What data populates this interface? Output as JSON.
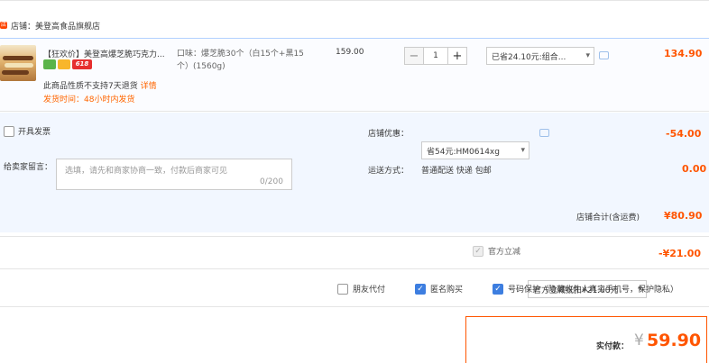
{
  "shop": {
    "name": "店铺：美登高食品旗舰店"
  },
  "item": {
    "title": "【狂欢价】美登高爆芝脆巧克力...",
    "badge_618": "618",
    "no_return": "此商品性质不支持7天退货",
    "detail_link": "详情",
    "ship_time": "发货时间：48小时内发货",
    "attr": "口味：爆芝脆30个（白15个+黑15个）(1560g)",
    "price": "159.00",
    "qty": "1",
    "qty_minus": "−",
    "qty_plus": "+",
    "promo": "已省24.10元:组合...",
    "total": "134.90"
  },
  "extras": {
    "invoice_label": "开具发票",
    "message_label": "给卖家留言：",
    "message_placeholder": "选填，请先和商家协商一致，付款后商家可见",
    "message_count": "0/200",
    "coupon_label": "店铺优惠：",
    "coupon_value": "省54元:HM0614xg",
    "coupon_amount": "-54.00",
    "shipping_label": "运送方式：",
    "shipping_value": "普通配送 快递 包邮",
    "shipping_amount": "0.00",
    "subtotal_label": "店铺合计(含运费)",
    "subtotal_amount": "¥80.90"
  },
  "direct": {
    "label": "官方立减",
    "value": "官方立减抵扣¥21.00元",
    "amount": "-¥21.00"
  },
  "options": {
    "friend_pay": "朋友代付",
    "anonymous": "匿名购买",
    "number_protect": "号码保护（隐藏收件人真实手机号，保护隐私）"
  },
  "payment": {
    "label": "实付款：",
    "currency": "¥",
    "amount": "59.90"
  },
  "colors": {
    "accent": "#ff5500",
    "link_blue": "#3d7ee0",
    "panel": "#f2f7ff"
  }
}
